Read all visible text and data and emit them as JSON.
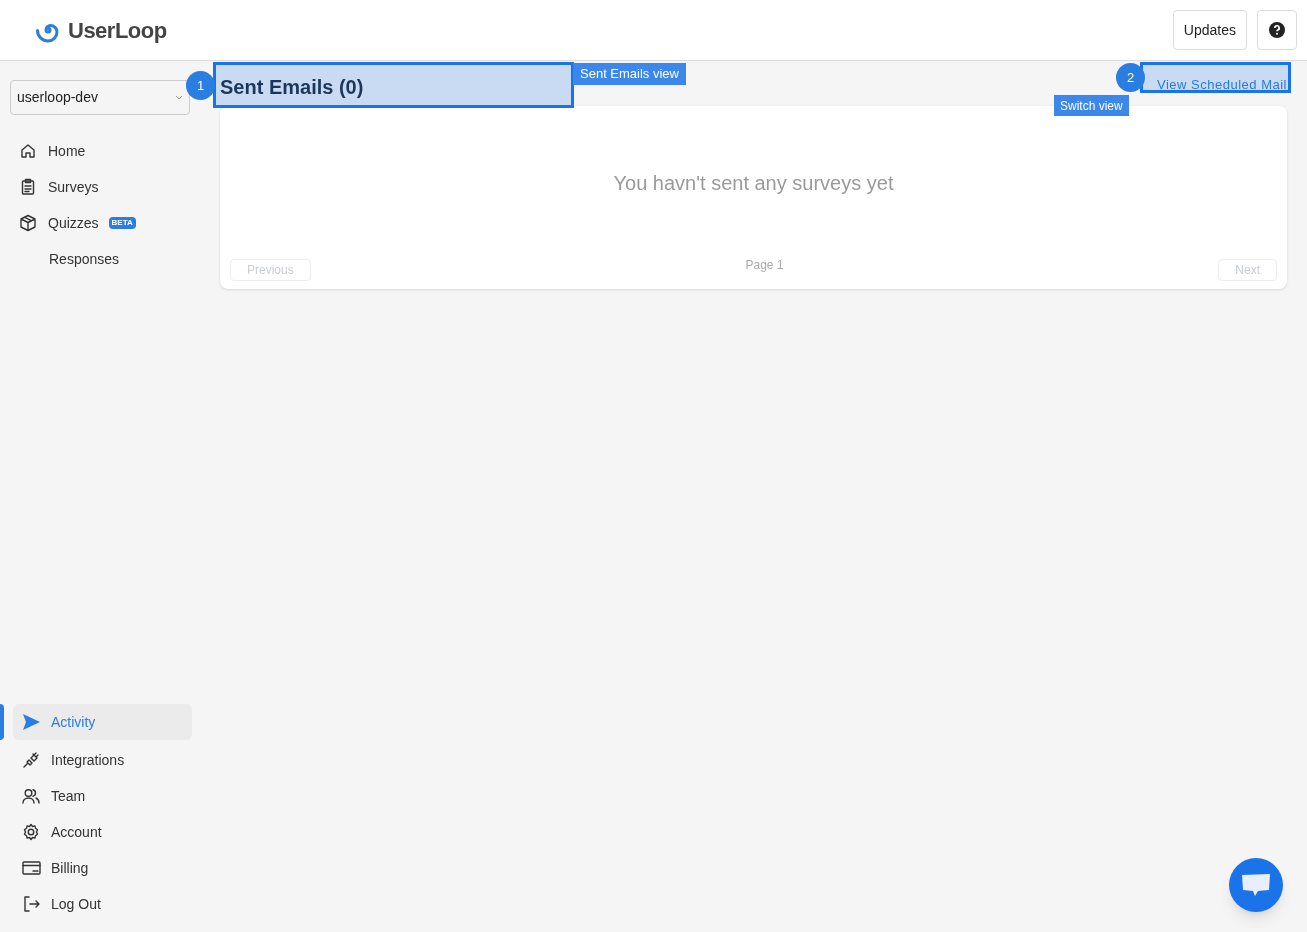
{
  "header": {
    "brand": "UserLoop",
    "buttons": [
      "Updates"
    ]
  },
  "sidebar": {
    "workspace_select": {
      "value": "userloop-dev"
    },
    "top_items": [
      {
        "label": "Home",
        "selected": false
      },
      {
        "label": "Surveys",
        "selected": false
      },
      {
        "label": "Quizzes",
        "selected": false,
        "badge": "BETA"
      },
      {
        "label": "Responses",
        "selected": false
      }
    ],
    "bottom_items": [
      {
        "label": "Activity",
        "selected": true
      },
      {
        "label": "Integrations",
        "selected": false
      },
      {
        "label": "Team",
        "selected": false
      },
      {
        "label": "Account",
        "selected": false
      },
      {
        "label": "Billing",
        "selected": false
      },
      {
        "label": "Log Out",
        "selected": false
      }
    ]
  },
  "main": {
    "title": "Sent Emails (0)",
    "switch_link": "View Scheduled Mail",
    "empty_message": "You havn't sent any surveys yet",
    "pagination": {
      "previous": "Previous",
      "page": "Page 1",
      "next": "Next"
    }
  },
  "annotations": [
    {
      "number": "1",
      "label": "Sent Emails view"
    },
    {
      "number": "2",
      "label": "Switch view"
    }
  ]
}
